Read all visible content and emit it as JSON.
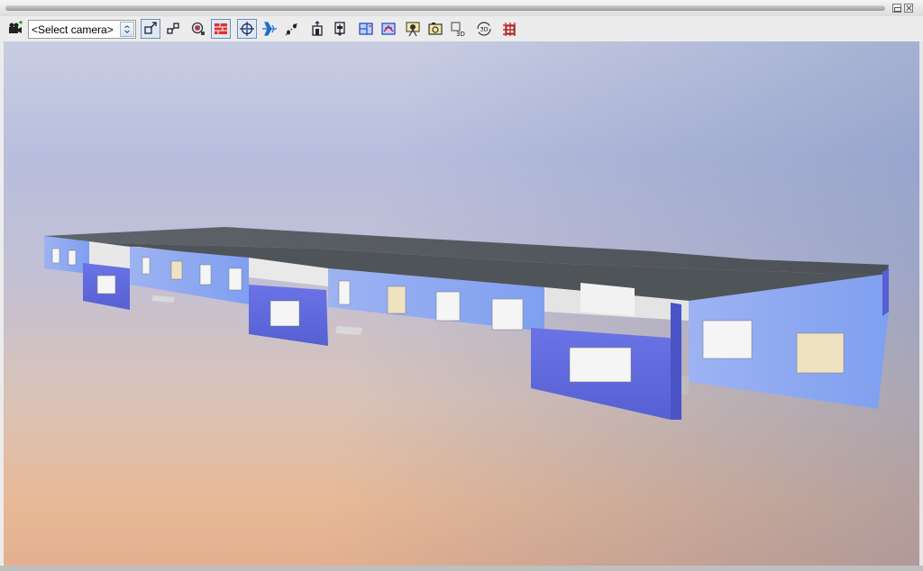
{
  "toolbar": {
    "camera_select": {
      "value": "<Select camera>"
    },
    "icons": [
      "add-camera-icon",
      "camera-dropdown-arrow-icon",
      "zoom-extents-icon",
      "zoom-window-icon",
      "render-mode-icon",
      "walls-display-icon",
      "orbit-icon",
      "fly-mode-icon",
      "walk-path-icon",
      "section-plane-icon",
      "elevation-view-icon",
      "floor-plan-icon",
      "layers-icon",
      "camera-view-icon",
      "snapshot-icon",
      "export-3d-icon",
      "rotate-3d-icon",
      "grid-frame-icon"
    ],
    "labels": {
      "export_3d": "3D",
      "rotate_3d": "3D"
    }
  },
  "colors": {
    "wall_light": "#8ea8f0",
    "wall_dark": "#5a64d8",
    "roof": "#555a60",
    "interior": "#e6e6e6"
  }
}
